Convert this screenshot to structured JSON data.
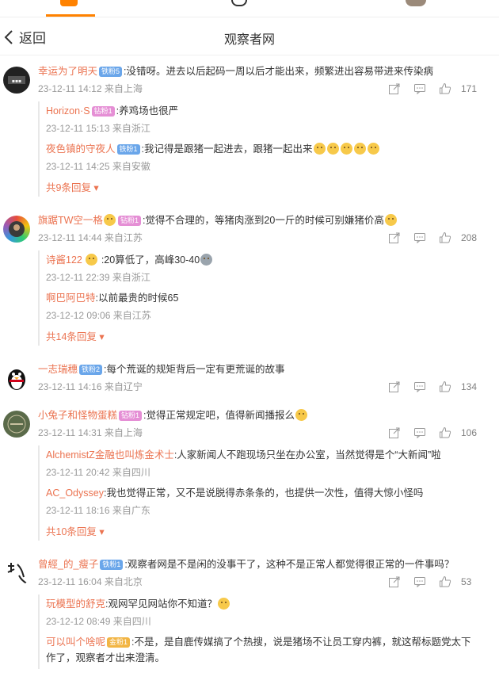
{
  "nav": {
    "back_label": "返回",
    "title": "观察者网"
  },
  "colors": {
    "accent": "#ff8200",
    "username": "#eb7350",
    "meta": "#999999"
  },
  "comments": [
    {
      "user": "幸运为了明天",
      "badge": "铁粉5",
      "text": ":没错呀。进去以后起码一周以后才能出来，频繁进出容易带进来传染病",
      "time": "23-12-11 14:12 来自上海",
      "likes": "171",
      "replies": [
        {
          "user": "Horizon·S",
          "badge": "钻粉1",
          "text": ":养鸡场也很严",
          "time": "23-12-11 15:13 来自浙江"
        },
        {
          "user": "夜色镇的守夜人",
          "badge": "铁粉1",
          "text": ":我记得是跟猪一起进去，跟猪一起出来",
          "time": "23-12-11 14:25 来自安徽"
        }
      ],
      "more": "共9条回复"
    },
    {
      "user": "旗踞TW空一格",
      "badge": "钻粉1",
      "text": ":觉得不合理的，等猪肉涨到20一斤的时候可别嫌猪价高",
      "time": "23-12-11 14:44 来自江苏",
      "likes": "208",
      "replies": [
        {
          "user": "诗酱122",
          "badge": "",
          "text": ":20算低了，高峰30-40",
          "time": "23-12-11 22:39 来自浙江"
        },
        {
          "user": "啊巴阿巴特",
          "badge": "",
          "text": ":以前最贵的时候65",
          "time": "23-12-12 09:06 来自江苏"
        }
      ],
      "more": "共14条回复"
    },
    {
      "user": "一志瑞穗",
      "badge": "铁粉2",
      "text": ":每个荒诞的规矩背后一定有更荒诞的故事",
      "time": "23-12-11 14:16 来自辽宁",
      "likes": "134",
      "replies": [],
      "more": ""
    },
    {
      "user": "小兔子和怪物蛋糕",
      "badge": "钻粉1",
      "text": ":觉得正常规定吧，值得新闻播报么",
      "time": "23-12-11 14:31 来自上海",
      "likes": "106",
      "replies": [
        {
          "user": "AlchemistZ金融也叫炼金术士",
          "badge": "",
          "text": ":人家新闻人不跑现场只坐在办公室，当然觉得是个“大新闻”啦",
          "time": "23-12-11 20:42 来自四川"
        },
        {
          "user": "AC_Odyssey",
          "badge": "",
          "text": ":我也觉得正常，又不是说脱得赤条条的，也提供一次性，值得大惊小怪吗",
          "time": "23-12-11 18:16 来自广东"
        }
      ],
      "more": "共10条回复"
    },
    {
      "user": "曾經_的_瘦子",
      "badge": "铁粉1",
      "text": ":观察者网是不是闲的没事干了，这种不是正常人都觉得很正常的一件事吗？",
      "time": "23-12-11 16:04 来自北京",
      "likes": "53",
      "replies": [
        {
          "user": "玩模型的舒克",
          "badge": "",
          "text": ":观网罕见网站你不知道？",
          "time": "23-12-12 08:49 来自四川"
        },
        {
          "user": "可以叫个啥呢",
          "badge": "金粉1",
          "text": ":不是，是自鹿传媒搞了个热搜，说是猪场不让员工穿内裤，就这帮标题党太下作了，观察者才出来澄清。",
          "time": ""
        }
      ],
      "more": ""
    }
  ]
}
